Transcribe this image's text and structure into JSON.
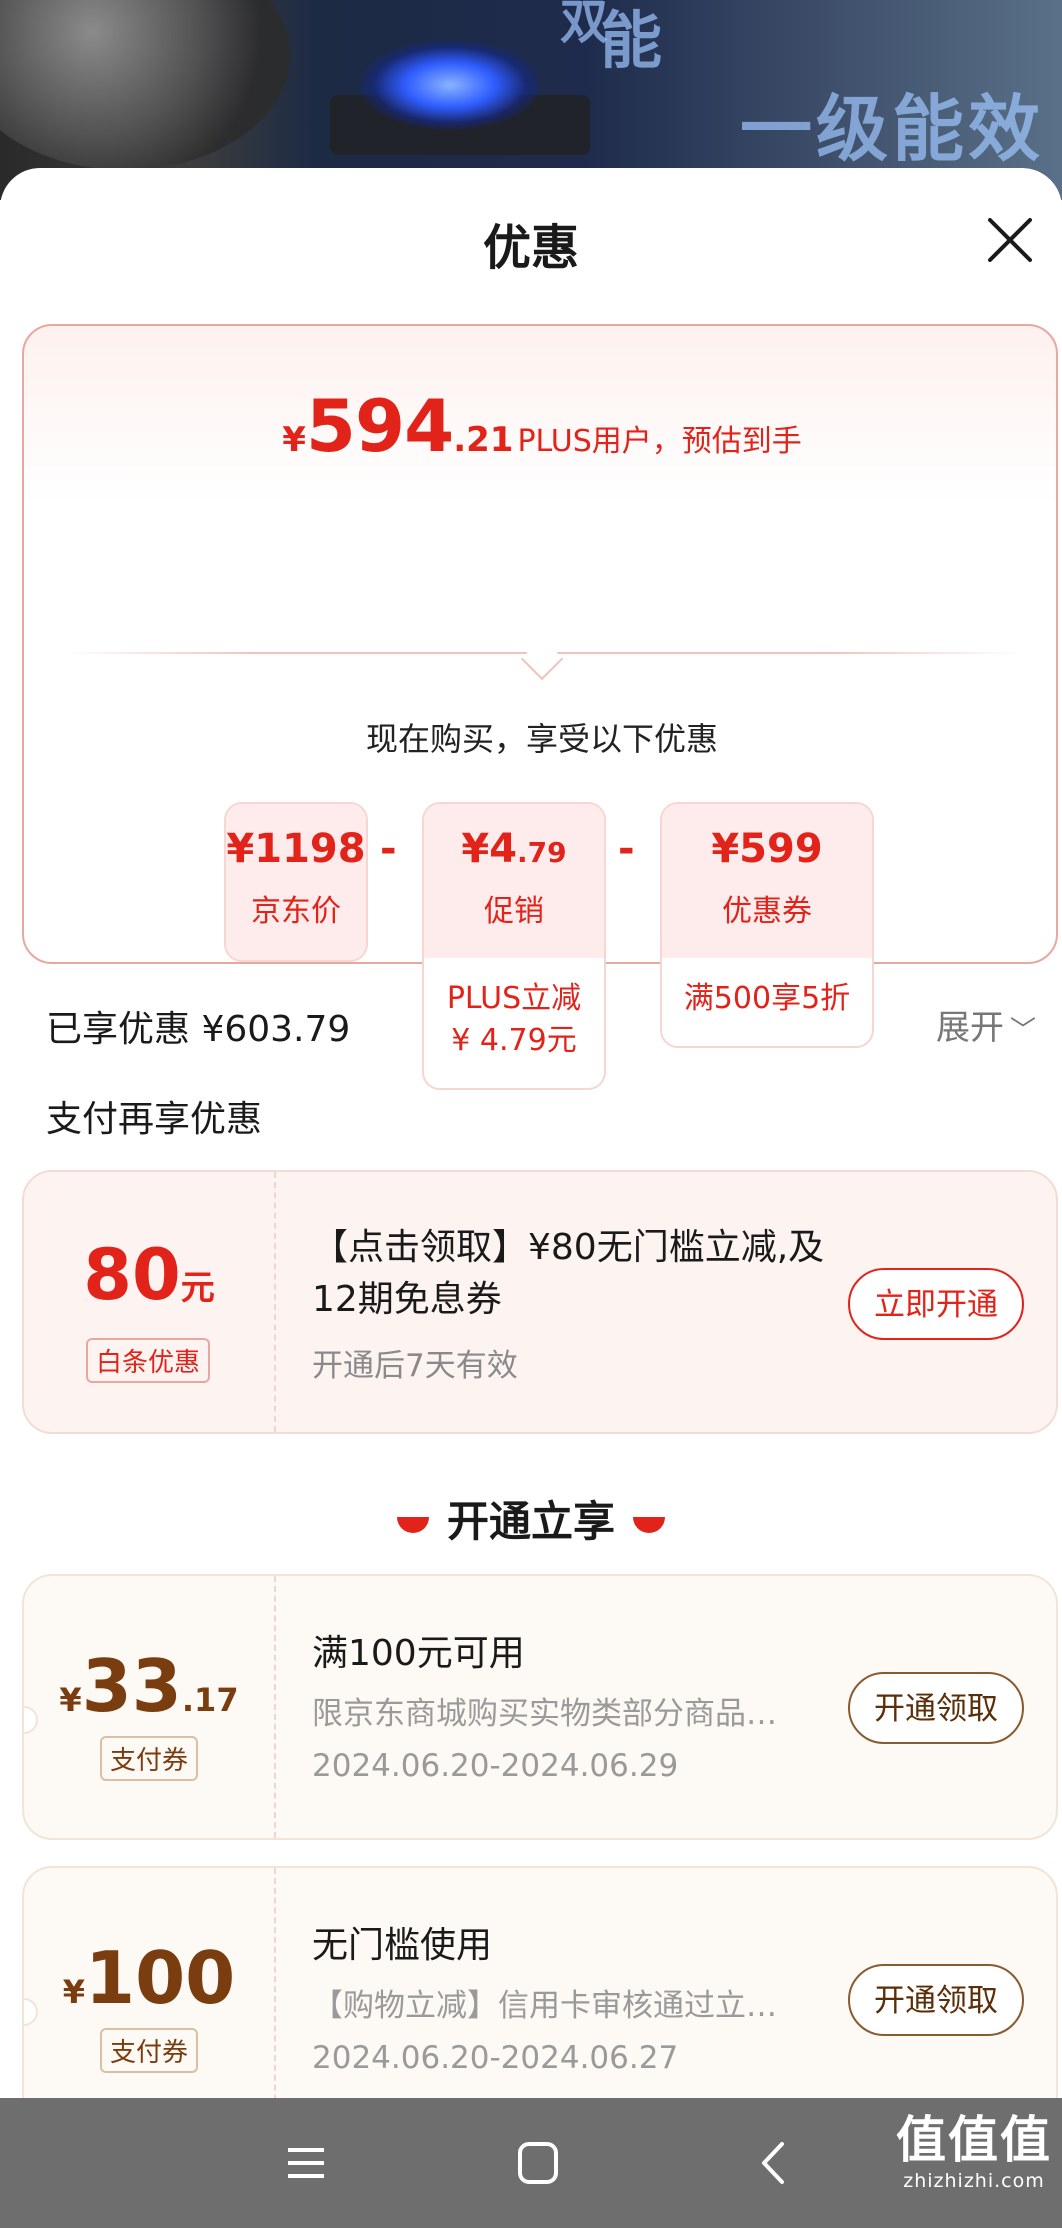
{
  "sheet": {
    "title": "优惠"
  },
  "summary": {
    "currency": "¥",
    "price_int": "594",
    "price_dec": ".21",
    "price_note": "PLUS用户，预估到手",
    "enjoy_text": "现在购买，享受以下优惠",
    "minus": "-",
    "boxes": [
      {
        "amount": "¥1198",
        "label": "京东价"
      },
      {
        "amount": "¥4",
        "amount_dec": ".79",
        "label": "促销",
        "sub": "PLUS立减\n¥ 4.79元"
      },
      {
        "amount": "¥599",
        "label": "优惠券",
        "sub": "满500享5折"
      }
    ]
  },
  "enjoyed": {
    "text": "已享优惠 ¥603.79",
    "expand_label": "展开"
  },
  "pay_section_title": "支付再享优惠",
  "baitiao_coupon": {
    "amount": "80",
    "unit": "元",
    "tag": "白条优惠",
    "title": "【点击领取】¥80无门槛立减,及12期免息券",
    "valid": "开通后7天有效",
    "button": "立即开通"
  },
  "section_head": "开通立享",
  "pay_coupons": [
    {
      "yen": "¥",
      "amount": "33",
      "amount_dec": ".17",
      "tag": "支付券",
      "title": "满100元可用",
      "desc": "限京东商城购买实物类部分商品…",
      "dates": "2024.06.20-2024.06.29",
      "button": "开通领取"
    },
    {
      "yen": "¥",
      "amount": "100",
      "amount_dec": "",
      "tag": "支付券",
      "title": "无门槛使用",
      "desc": "【购物立减】信用卡审核通过立…",
      "dates": "2024.06.20-2024.06.27",
      "button": "开通领取"
    }
  ],
  "hero_text": [
    "一级能效",
    "能",
    "双"
  ],
  "watermark": {
    "logo": "值值值",
    "domain": "zhizhizhi.com"
  },
  "colors": {
    "accent": "#e2231a",
    "gold": "#7a3d10",
    "navbar": "#6e6e6e"
  },
  "icons": {
    "close": "close-icon",
    "menu": "menu-icon",
    "home": "home-icon",
    "back": "back-icon"
  }
}
